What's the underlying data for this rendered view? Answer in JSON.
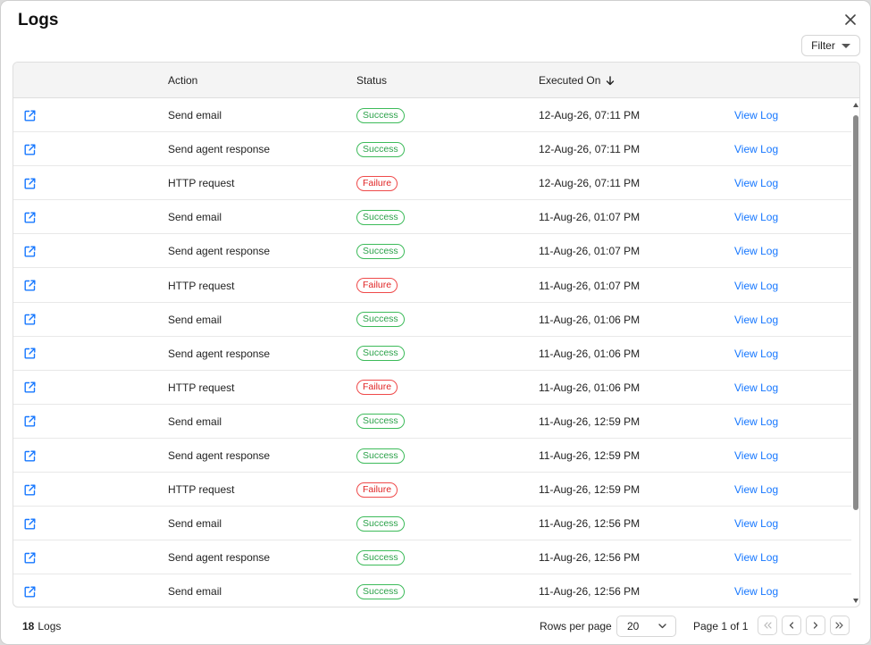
{
  "dialog": {
    "title": "Logs",
    "filter_label": "Filter"
  },
  "table": {
    "headers": {
      "action": "Action",
      "status": "Status",
      "executed_on": "Executed On"
    },
    "sort_icon": "arrow-down-icon",
    "rows": [
      {
        "action": "Send email",
        "status": "Success",
        "executed_on": "12-Aug-26, 07:11 PM",
        "link": "View Log"
      },
      {
        "action": "Send agent response",
        "status": "Success",
        "executed_on": "12-Aug-26, 07:11 PM",
        "link": "View Log"
      },
      {
        "action": "HTTP request",
        "status": "Failure",
        "executed_on": "12-Aug-26, 07:11 PM",
        "link": "View Log"
      },
      {
        "action": "Send email",
        "status": "Success",
        "executed_on": "11-Aug-26, 01:07 PM",
        "link": "View Log"
      },
      {
        "action": "Send agent response",
        "status": "Success",
        "executed_on": "11-Aug-26, 01:07 PM",
        "link": "View Log"
      },
      {
        "action": "HTTP request",
        "status": "Failure",
        "executed_on": "11-Aug-26, 01:07 PM",
        "link": "View Log"
      },
      {
        "action": "Send email",
        "status": "Success",
        "executed_on": "11-Aug-26, 01:06 PM",
        "link": "View Log"
      },
      {
        "action": "Send agent response",
        "status": "Success",
        "executed_on": "11-Aug-26, 01:06 PM",
        "link": "View Log"
      },
      {
        "action": "HTTP request",
        "status": "Failure",
        "executed_on": "11-Aug-26, 01:06 PM",
        "link": "View Log"
      },
      {
        "action": "Send email",
        "status": "Success",
        "executed_on": "11-Aug-26, 12:59 PM",
        "link": "View Log"
      },
      {
        "action": "Send agent response",
        "status": "Success",
        "executed_on": "11-Aug-26, 12:59 PM",
        "link": "View Log"
      },
      {
        "action": "HTTP request",
        "status": "Failure",
        "executed_on": "11-Aug-26, 12:59 PM",
        "link": "View Log"
      },
      {
        "action": "Send email",
        "status": "Success",
        "executed_on": "11-Aug-26, 12:56 PM",
        "link": "View Log"
      },
      {
        "action": "Send agent response",
        "status": "Success",
        "executed_on": "11-Aug-26, 12:56 PM",
        "link": "View Log"
      },
      {
        "action": "Send email",
        "status": "Success",
        "executed_on": "11-Aug-26, 12:56 PM",
        "link": "View Log"
      }
    ]
  },
  "footer": {
    "count_number": "18",
    "count_label": "Logs",
    "rows_per_page_label": "Rows per page",
    "rows_per_page_value": "20",
    "page_info": "Page 1 of 1"
  },
  "colors": {
    "link": "#1677ff",
    "success": "#2ca24a",
    "failure": "#e02424",
    "header_bg": "#f4f4f4"
  },
  "icons": {
    "row": "external-link-icon",
    "close": "close-icon",
    "filter": "caret-down-icon",
    "select": "chevron-down-icon",
    "first": "chevrons-left-icon",
    "prev": "chevron-left-icon",
    "next": "chevron-right-icon",
    "last": "chevrons-right-icon"
  }
}
